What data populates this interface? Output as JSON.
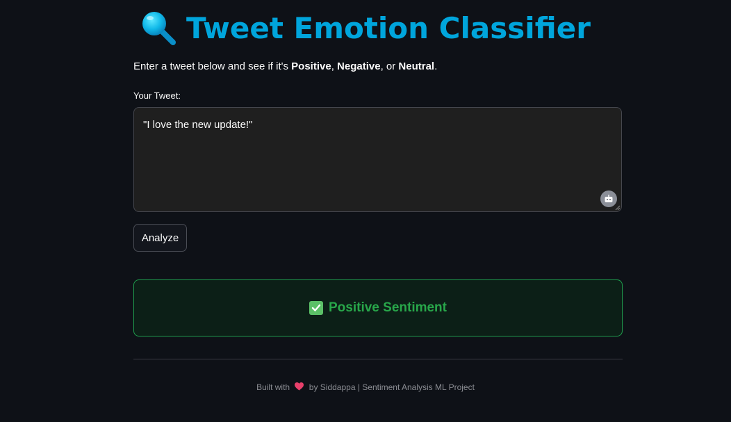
{
  "header": {
    "title": "Tweet Emotion Classifier",
    "icon": "magnifier-icon",
    "title_color": "#00a5dc"
  },
  "intro": {
    "prefix": "Enter a tweet below and see if it's ",
    "positive": "Positive",
    "sep1": ", ",
    "negative": "Negative",
    "sep2": ", or ",
    "neutral": "Neutral",
    "suffix": "."
  },
  "form": {
    "label": "Your Tweet:",
    "value": "\"I love the new update!\"",
    "assist_icon": "robot-icon",
    "button_label": "Analyze"
  },
  "result": {
    "icon": "check-box-icon",
    "text": "Positive Sentiment",
    "color": "#28a74a"
  },
  "footer": {
    "built_with": "Built with",
    "heart": "heart-icon",
    "credit": "by Siddappa | Sentiment Analysis ML Project"
  }
}
